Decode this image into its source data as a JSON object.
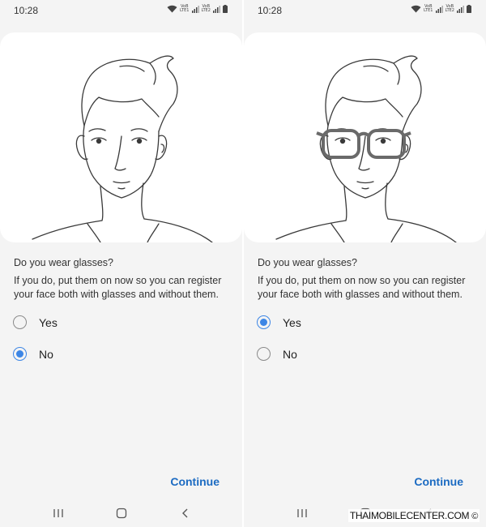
{
  "screens": [
    {
      "status_time": "10:28",
      "question": "Do you wear glasses?",
      "description": "If you do, put them on now so you can register your face both with glasses and without them.",
      "options": [
        {
          "label": "Yes",
          "selected": false
        },
        {
          "label": "No",
          "selected": true
        }
      ],
      "continue_label": "Continue",
      "glasses_shown": false
    },
    {
      "status_time": "10:28",
      "question": "Do you wear glasses?",
      "description": "If you do, put them on now so you can register your face both with glasses and without them.",
      "options": [
        {
          "label": "Yes",
          "selected": true
        },
        {
          "label": "No",
          "selected": false
        }
      ],
      "continue_label": "Continue",
      "glasses_shown": true
    }
  ],
  "status_icons": [
    "wifi-icon",
    "volte-lte1-icon",
    "signal-icon",
    "volte-lte2-icon",
    "signal-icon",
    "battery-icon"
  ],
  "volte": {
    "top": "VoB",
    "lte1": "LTE1",
    "lte2": "LTE2"
  },
  "nav_icons": [
    "recent-apps-icon",
    "home-icon",
    "back-icon"
  ],
  "watermark": {
    "text": "THAIMOBILECENTER.COM",
    "symbol": "©"
  },
  "colors": {
    "accent": "#3d86e5",
    "continue": "#1c6bc2",
    "background": "#f4f4f4",
    "card": "#ffffff"
  }
}
